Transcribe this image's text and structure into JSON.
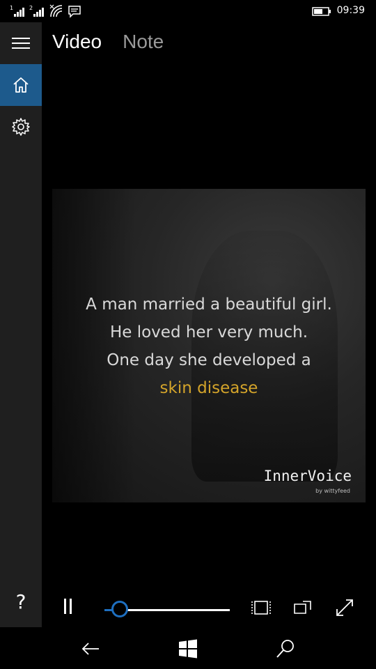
{
  "status_bar": {
    "time": "09:39",
    "icons": [
      "signal-sim1-icon",
      "signal-sim2-icon",
      "wifi-icon",
      "message-icon",
      "battery-icon"
    ],
    "sim1_label": "1",
    "sim2_label": "2"
  },
  "sidebar": {
    "items": [
      {
        "name": "menu",
        "icon": "hamburger-icon"
      },
      {
        "name": "home",
        "icon": "home-icon",
        "active": true
      },
      {
        "name": "settings",
        "icon": "gear-icon"
      }
    ],
    "help_label": "?"
  },
  "tabs": [
    {
      "label": "Video",
      "active": true
    },
    {
      "label": "Note",
      "active": false
    }
  ],
  "video": {
    "caption_lines": [
      "A man married a beautiful girl.",
      "He loved her very much.",
      "One day she developed a",
      "skin disease"
    ],
    "brand": "InnerVoice",
    "brand_sub": "by wittyfeed",
    "highlight_color": "#d4a42a"
  },
  "player": {
    "state": "playing",
    "progress": 0.12,
    "buttons": [
      "pause-icon",
      "aspect-ratio-icon",
      "cast-icon",
      "fullscreen-icon"
    ]
  },
  "navbar": {
    "buttons": [
      "back-icon",
      "windows-start-icon",
      "search-icon"
    ]
  },
  "colors": {
    "accent": "#1e6fc0",
    "sidebar_active": "#1d5a8c",
    "sidebar_bg": "#1f1f1f"
  }
}
